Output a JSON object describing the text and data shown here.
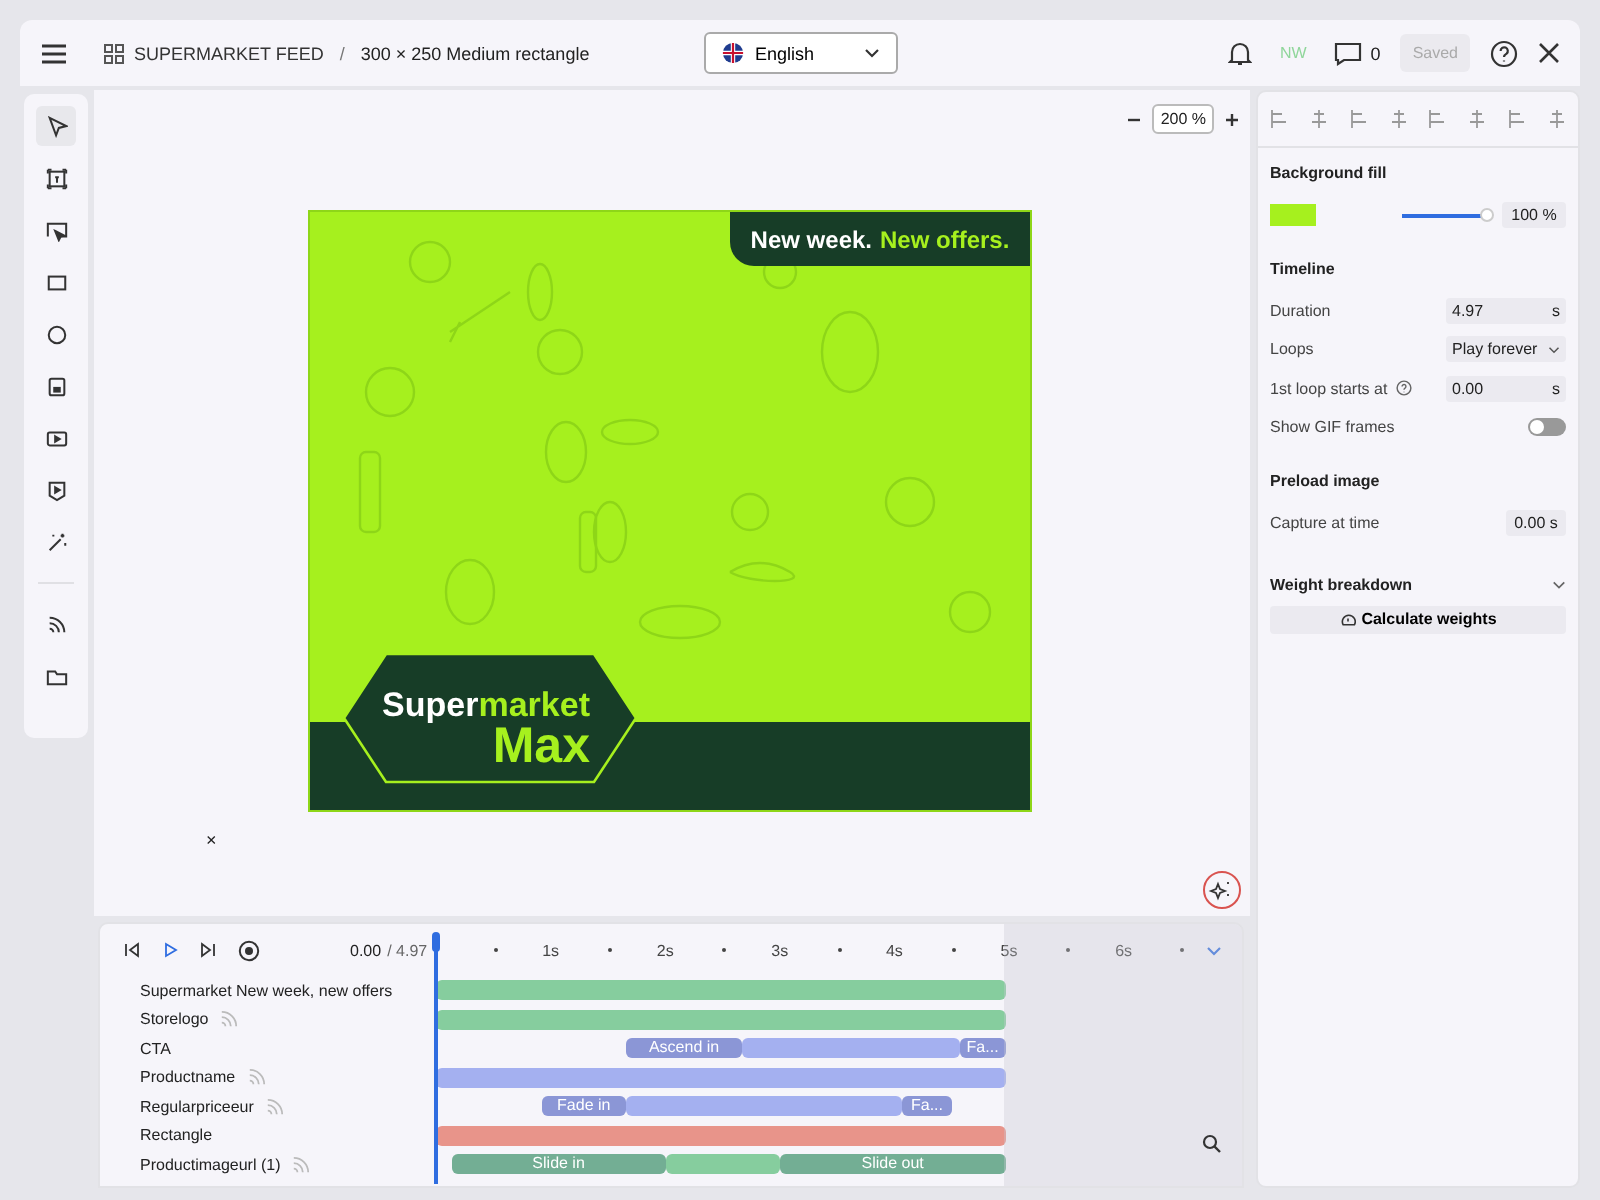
{
  "topbar": {
    "project": "SUPERMARKET FEED",
    "separator": "/",
    "document": "300 × 250 Medium rectangle",
    "language": "English",
    "user_initials": "NW",
    "comment_count": "0",
    "save_button": {
      "label": "Saved",
      "disabled": true
    }
  },
  "tools": [
    {
      "selected": true
    },
    {
      "selected": false
    },
    {
      "selected": false
    },
    {
      "selected": false
    },
    {
      "selected": false
    },
    {
      "selected": false
    },
    {
      "selected": false
    },
    {
      "selected": false
    },
    {
      "selected": false
    },
    {
      "selected": false
    },
    {
      "selected": false
    }
  ],
  "canvas": {
    "zoom": "200 %",
    "banner": {
      "headline": [
        "New week.",
        "New offers."
      ],
      "logo": [
        "Super",
        "market",
        "Max"
      ]
    },
    "close_mark": "×"
  },
  "panel": {
    "background_fill": {
      "title": "Background fill",
      "color": "#a6f01e",
      "opacity": {
        "level": 1.0,
        "value": "100 %"
      }
    },
    "timeline": {
      "title": "Timeline",
      "duration": {
        "label": "Duration",
        "value": "4.97",
        "unit": "s"
      },
      "loops": {
        "label": "Loops",
        "value": "Play forever"
      },
      "first_loop": {
        "label": "1st loop starts at",
        "value": "0.00",
        "unit": "s"
      },
      "gif_frames": {
        "label": "Show GIF frames",
        "on": false
      }
    },
    "preload": {
      "title": "Preload image",
      "capture": {
        "label": "Capture at time",
        "value": "0.00 s"
      }
    },
    "weight": {
      "title": "Weight breakdown",
      "expanded": false,
      "button": "Calculate weights"
    }
  },
  "timeline": {
    "current": "0.00",
    "total": "/ 4.97",
    "ruler": [
      "1s",
      "2s",
      "3s",
      "4s",
      "5s",
      "6s"
    ],
    "tracks": [
      {
        "name": "Supermarket New week, new offers",
        "feed": false,
        "color": "#86cd9e",
        "segments": [
          {
            "kind": "hold"
          }
        ]
      },
      {
        "name": "Storelogo",
        "feed": true,
        "color": "#86cd9e",
        "segments": [
          {
            "kind": "hold"
          }
        ]
      },
      {
        "name": "CTA",
        "feed": false,
        "color": "#a4b0f0",
        "segments": [
          {
            "kind": "effect",
            "label": "Ascend in"
          },
          {
            "kind": "hold"
          },
          {
            "kind": "effect",
            "label": "Fa..."
          }
        ]
      },
      {
        "name": "Productname",
        "feed": true,
        "color": "#a4b0f0",
        "segments": [
          {
            "kind": "hold"
          }
        ]
      },
      {
        "name": "Regularpriceeur",
        "feed": true,
        "color": "#a4b0f0",
        "segments": [
          {
            "kind": "effect",
            "label": "Fade in"
          },
          {
            "kind": "hold"
          },
          {
            "kind": "effect",
            "label": "Fa..."
          }
        ]
      },
      {
        "name": "Rectangle",
        "feed": false,
        "color": "#e8948a",
        "segments": [
          {
            "kind": "hold"
          }
        ]
      },
      {
        "name": "Productimageurl (1)",
        "feed": true,
        "color": "#86cd9e",
        "segments": [
          {
            "kind": "effect",
            "label": "Slide in"
          },
          {
            "kind": "hold"
          },
          {
            "kind": "effect",
            "label": "Slide out"
          }
        ]
      }
    ]
  }
}
